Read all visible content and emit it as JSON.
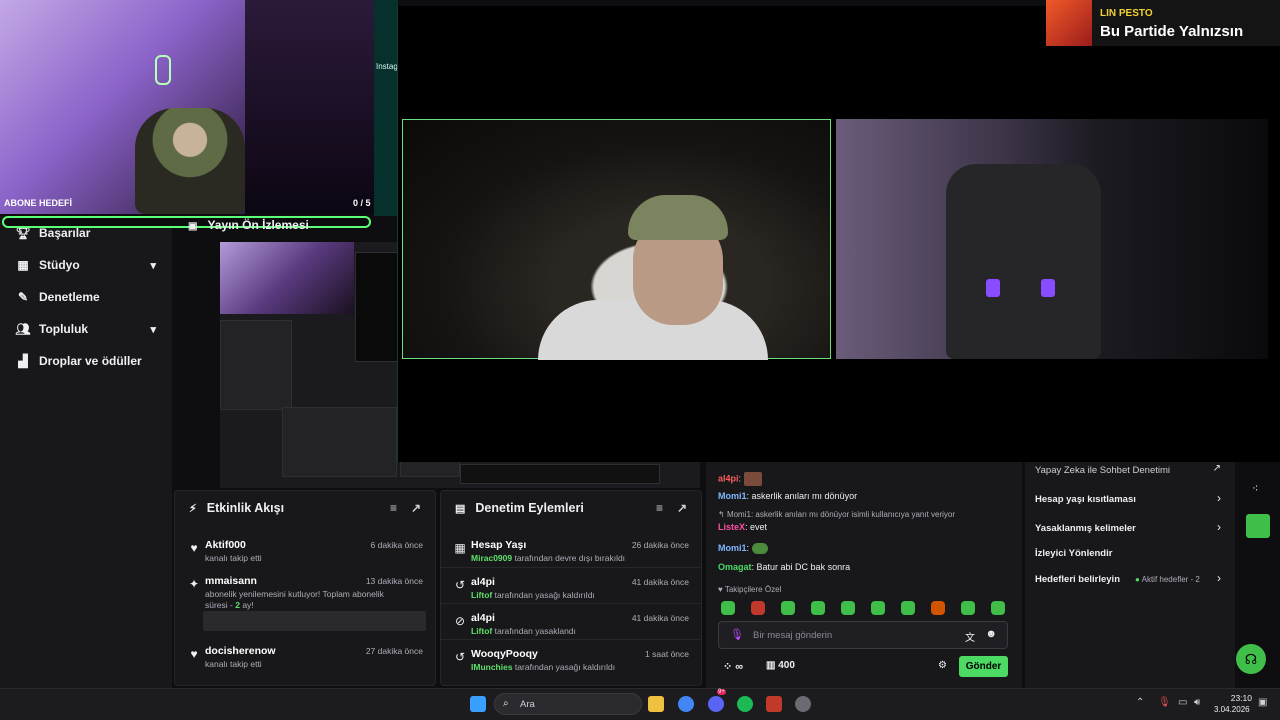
{
  "webcam": {
    "goal_label": "ABONE HEDEFİ",
    "goal_count": "0 / 5"
  },
  "preview": {
    "title": "Yayın Ön İzlemesi",
    "side_text": "Instag"
  },
  "nav": {
    "items": [
      {
        "label": "Başarılar",
        "icon": "trophy-icon"
      },
      {
        "label": "Stüdyo",
        "icon": "studio-icon",
        "chevron": "⌄"
      },
      {
        "label": "Denetleme",
        "icon": "wrench-icon"
      },
      {
        "label": "Topluluk",
        "icon": "community-icon",
        "chevron": "⌄"
      },
      {
        "label": "Droplar ve ödüller",
        "icon": "drops-icon"
      }
    ]
  },
  "music": {
    "artist": "LIN PESTO",
    "song": "Bu Partide Yalnızsın"
  },
  "activity": {
    "title": "Etkinlik Akışı",
    "items": [
      {
        "name": "Aktif000",
        "sub": "kanalı takip etti",
        "time": "6 dakika önce",
        "icon": "heart-icon"
      },
      {
        "name": "mmaisann",
        "sub": "abonelik yenilemesini kutluyor! Toplam abonelik süresi - ",
        "sub_bold": "2",
        "sub_end": " ay!",
        "time": "13 dakika önce",
        "icon": "sub-icon"
      },
      {
        "name": "docisherenow",
        "sub": "kanalı takip etti",
        "time": "27 dakika önce",
        "icon": "heart-icon"
      }
    ]
  },
  "mod": {
    "title": "Denetim Eylemleri",
    "items": [
      {
        "name": "Hesap Yaşı",
        "who": "Mirac0909",
        "sub": " tarafından devre dışı bırakıldı",
        "time": "26 dakika önce",
        "icon": "calendar-icon"
      },
      {
        "name": "al4pi",
        "who": "Liftof",
        "sub": " tarafından yasağı kaldırıldı",
        "time": "41 dakika önce",
        "icon": "undo-icon"
      },
      {
        "name": "al4pi",
        "who": "Liftof",
        "sub": " tarafından yasaklandı",
        "time": "41 dakika önce",
        "icon": "ban-icon"
      },
      {
        "name": "WooqyPooqy",
        "who": "IMunchies",
        "sub": " tarafından yasağı kaldırıldı",
        "time": "1 saat önce",
        "icon": "undo-icon"
      }
    ]
  },
  "chat": {
    "messages": [
      {
        "user": "al4pi",
        "color": "#ff5c5c",
        "text": ""
      },
      {
        "user": "Momi1",
        "color": "#7fb7ff",
        "text": "askerlik anıları mı dönüyor"
      },
      {
        "reply": "Momi1: askerlik anıları mı dönüyor isimli kullanıcıya yanıt veriyor"
      },
      {
        "user": "ListeX",
        "color": "#ff4fa3",
        "text": "evet"
      },
      {
        "user": "Momi1",
        "color": "#7fb7ff",
        "text": ""
      },
      {
        "user": "Omagat",
        "color": "#4cd964",
        "text": "Batur abi DC bak sonra"
      }
    ],
    "followers_only": "Takipçilere Özel",
    "placeholder": "Bir mesaj gönderin",
    "points": "400",
    "infinity": "∞",
    "send": "Gönder"
  },
  "settings": {
    "items": [
      {
        "label": "Yapay Zeka ile Sohbet Denetimi",
        "arrow": "↗"
      },
      {
        "label": "Hesap yaşı kısıtlaması",
        "arrow": "›"
      },
      {
        "label": "Yasaklanmış kelimeler",
        "arrow": "›"
      },
      {
        "label": "İzleyici Yönlendir",
        "arrow": ""
      },
      {
        "label": "Hedefleri belirleyin",
        "note": "Aktif hedefler - 2",
        "arrow": "›"
      }
    ]
  },
  "taskbar": {
    "search": "Ara",
    "time": "23:10",
    "date": "3.04.2026",
    "discord_badge": "9+"
  }
}
